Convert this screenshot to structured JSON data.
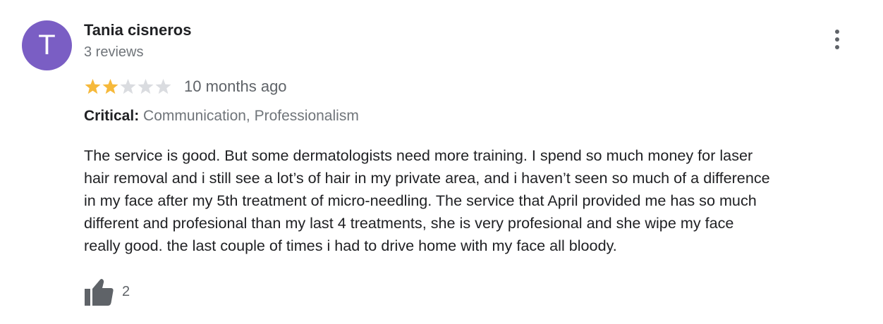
{
  "review": {
    "avatar_letter": "T",
    "avatar_color": "#7a5ec4",
    "author_name": "Tania cisneros",
    "author_review_count": "3 reviews",
    "rating": 2,
    "rating_max": 5,
    "star_filled_color": "#f6b93b",
    "star_empty_color": "#dadce0",
    "timestamp": "10 months ago",
    "critical_label": "Critical:",
    "critical_values": "Communication, Professionalism",
    "text": "The service is good. But some dermatologists need more training. I spend so much money for laser\nhair removal and i still see a lot’s of hair in my private area,  and i haven’t seen so much of a difference\nin my face after my 5th treatment of micro-needling. The service that April provided me has so much\ndifferent and profesional than my last 4 treatments, she is very profesional and she wipe my face\nreally good. the last couple of times i had to drive home with my face all bloody.",
    "helpful_count": "2",
    "icons": {
      "more": "more-vert-icon",
      "helpful": "thumbs-up-icon",
      "star": "star-icon"
    }
  }
}
